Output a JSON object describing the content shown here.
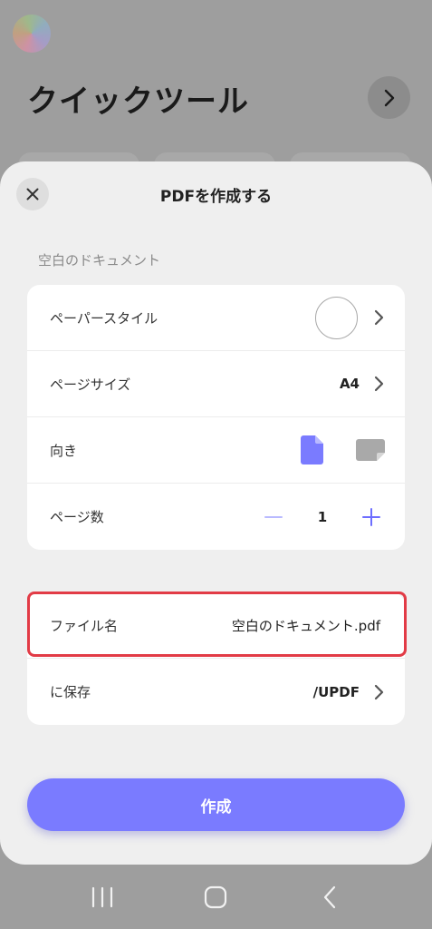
{
  "background": {
    "title": "クイックツール"
  },
  "sheet": {
    "title": "PDFを作成する",
    "section_label": "空白のドキュメント",
    "paper_style": {
      "label": "ペーパースタイル"
    },
    "page_size": {
      "label": "ページサイズ",
      "value": "A4"
    },
    "orientation": {
      "label": "向き",
      "selected": "portrait"
    },
    "page_count": {
      "label": "ページ数",
      "value": "1"
    },
    "file_name": {
      "label": "ファイル名",
      "value": "空白のドキュメント.pdf"
    },
    "save_to": {
      "label": "に保存",
      "value": "/UPDF"
    },
    "create_label": "作成"
  },
  "colors": {
    "accent": "#7a7bff",
    "highlight": "#e23b46",
    "sheet_bg": "#efefef"
  },
  "icons": {
    "close": "close-icon",
    "chevron": "chevron-right-icon",
    "portrait": "portrait-page-icon",
    "landscape": "landscape-page-icon",
    "minus": "minus-icon",
    "plus": "plus-icon"
  }
}
